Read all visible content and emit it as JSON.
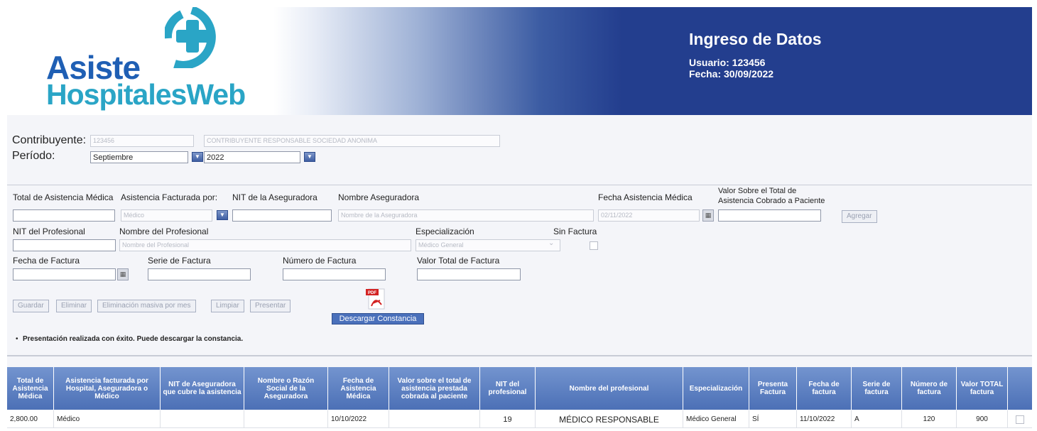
{
  "header": {
    "logo_line1": "Asiste",
    "logo_line2": "HospitalesWeb",
    "title": "Ingreso de Datos",
    "user": "Usuario: 123456",
    "date": "Fecha: 30/09/2022"
  },
  "contribuyente": {
    "label": "Contribuyente:",
    "id_value": "123456",
    "name_value": "CONTRIBUYENTE RESPONSABLE SOCIEDAD ANONIMA",
    "periodo_label": "Período:",
    "month_value": "Septiembre",
    "year_value": "2022"
  },
  "form": {
    "total_label": "Total de Asistencia Médica",
    "facturada_label": "Asistencia Facturada por:",
    "facturada_value": "Médico",
    "nit_aseg_label": "NIT de la Aseguradora",
    "nombre_aseg_label": "Nombre Aseguradora",
    "nombre_aseg_placeholder": "Nombre de la Aseguradora",
    "fecha_asist_label": "Fecha Asistencia Médica",
    "fecha_asist_value": "02/11/2022",
    "valor_label_1": "Valor Sobre el Total de",
    "valor_label_2": "Asistencia Cobrado a Paciente",
    "agregar_label": "Agregar",
    "nit_prof_label": "NIT del Profesional",
    "nombre_prof_label": "Nombre del Profesional",
    "nombre_prof_placeholder": "Nombre del Profesional",
    "especializacion_label": "Especialización",
    "especializacion_value": "Médico General",
    "sin_factura_label": "Sin Factura",
    "fecha_factura_label": "Fecha de Factura",
    "serie_factura_label": "Serie de Factura",
    "numero_factura_label": "Número de Factura",
    "valor_factura_label": "Valor Total de Factura"
  },
  "actions": {
    "guardar": "Guardar",
    "eliminar": "Eliminar",
    "eliminacion_masiva": "Eliminación masiva por mes",
    "limpiar": "Limpiar",
    "presentar": "Presentar",
    "descargar": "Descargar Constancia",
    "pdf_badge": "PDF"
  },
  "message": "Presentación realizada con éxito. Puede descargar la constancia.",
  "table": {
    "headers": [
      "Total de Asistencia Médica",
      "Asistencia facturada por Hospital, Aseguradora o Médico",
      "NIT de Aseguradora que cubre la asistencia",
      "Nombre o Razón Social de la Aseguradora",
      "Fecha de Asistencia Médica",
      "Valor sobre el total de asistencia prestada cobrada al paciente",
      "NIT del profesional",
      "Nombre del profesional",
      "Especialización",
      "Presenta Factura",
      "Fecha de factura",
      "Serie de factura",
      "Número de factura",
      "Valor TOTAL factura"
    ],
    "rows": [
      [
        "2,800.00",
        "Médico",
        "",
        "",
        "10/10/2022",
        "",
        "19",
        "MÉDICO RESPONSABLE",
        "Médico General",
        "SÍ",
        "11/10/2022",
        "A",
        "120",
        "900"
      ]
    ]
  }
}
